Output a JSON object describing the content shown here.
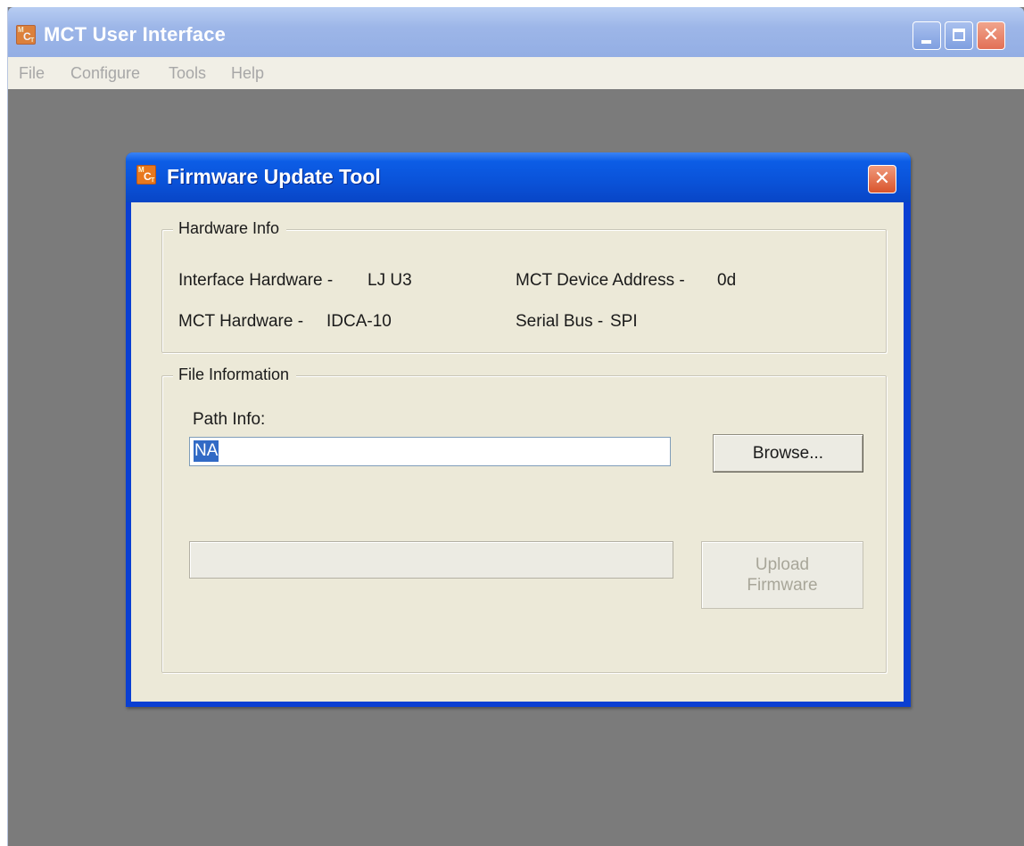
{
  "main_window": {
    "title": "MCT User Interface",
    "menu": [
      "File",
      "Configure",
      "Tools",
      "Help"
    ]
  },
  "icons": {
    "app_icon": "mct-app-icon",
    "minimize": "minimize-icon",
    "maximize": "maximize-icon",
    "close": "close-icon"
  },
  "dialog": {
    "title": "Firmware Update Tool",
    "hardware_info": {
      "legend": "Hardware Info",
      "interface_hardware_label": "Interface Hardware -",
      "interface_hardware_value": "LJ U3",
      "mct_device_address_label": "MCT Device Address -",
      "mct_device_address_value": "0d",
      "mct_hardware_label": "MCT Hardware -",
      "mct_hardware_value": "IDCA-10",
      "serial_bus_label": "Serial Bus -",
      "serial_bus_value": "SPI"
    },
    "file_information": {
      "legend": "File Information",
      "path_label": "Path Info:",
      "path_value": "NA",
      "browse_label": "Browse...",
      "upload_label_line1": "Upload",
      "upload_label_line2": "Firmware",
      "upload_enabled": false
    }
  },
  "colors": {
    "dialog_titlebar": "#0a52d8",
    "dialog_body": "#ece9d8",
    "main_client_area": "#7b7b7b",
    "selection_highlight": "#316ac5"
  }
}
